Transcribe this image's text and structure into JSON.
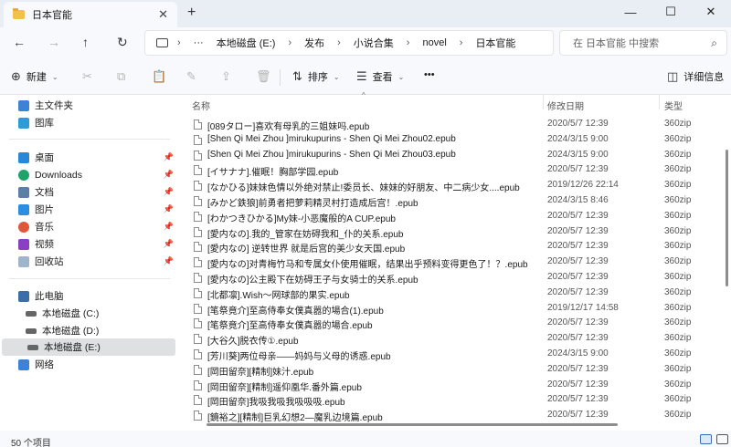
{
  "tab": {
    "title": "日本官能"
  },
  "breadcrumb": [
    "本地磁盘 (E:)",
    "发布",
    "小说合集",
    "novel",
    "日本官能"
  ],
  "search": {
    "placeholder": "在 日本官能 中搜索"
  },
  "toolbar": {
    "new_label": "新建",
    "sort_label": "排序",
    "view_label": "查看",
    "more_label": "•••",
    "details_label": "详细信息"
  },
  "sidebar": {
    "home": "主文件夹",
    "gallery": "图库",
    "quick": [
      "桌面",
      "Downloads",
      "文档",
      "图片",
      "音乐",
      "视频",
      "回收站"
    ],
    "this_pc": "此电脑",
    "drives": [
      "本地磁盘 (C:)",
      "本地磁盘 (D:)",
      "本地磁盘 (E:)"
    ],
    "network": "网络"
  },
  "columns": {
    "name": "名称",
    "date": "修改日期",
    "type": "类型"
  },
  "files": [
    {
      "name": "[089タロー]喜欢有母乳的三姐妹吗.epub",
      "date": "2020/5/7 12:39",
      "type": "360zip"
    },
    {
      "name": "[Shen Qi Mei Zhou ]mirukupurins - Shen Qi Mei Zhou02.epub",
      "date": "2024/3/15 9:00",
      "type": "360zip"
    },
    {
      "name": "[Shen Qi Mei Zhou ]mirukupurins - Shen Qi Mei Zhou03.epub",
      "date": "2024/3/15 9:00",
      "type": "360zip"
    },
    {
      "name": "[イサナナ].催眠！胸部学园.epub",
      "date": "2020/5/7 12:39",
      "type": "360zip"
    },
    {
      "name": "[なかひる]妹妹色情以外绝对禁止!委员长、妹妹的好朋友、中二病少女....epub",
      "date": "2019/12/26 22:14",
      "type": "360zip"
    },
    {
      "name": "[みかど鉄狼]前勇者把萝莉精灵村打造成后宫！.epub",
      "date": "2024/3/15 8:46",
      "type": "360zip"
    },
    {
      "name": "[わかつきひかる]My妹-小恶魔般的A CUP.epub",
      "date": "2020/5/7 12:39",
      "type": "360zip"
    },
    {
      "name": "[愛内なの].我的_管家在妨碍我和_仆的关系.epub",
      "date": "2020/5/7 12:39",
      "type": "360zip"
    },
    {
      "name": "[愛内なの] 逆转世界 就是后宫的美少女天国.epub",
      "date": "2020/5/7 12:39",
      "type": "360zip"
    },
    {
      "name": "[愛内なの]对青梅竹马和专属女仆使用催眠，结果出乎预料变得更色了！？.epub",
      "date": "2020/5/7 12:39",
      "type": "360zip"
    },
    {
      "name": "[愛内なの]公主殿下在妨碍王子与女骑士的关系.epub",
      "date": "2020/5/7 12:39",
      "type": "360zip"
    },
    {
      "name": "[北都凛].Wish～网球部的果实.epub",
      "date": "2020/5/7 12:39",
      "type": "360zip"
    },
    {
      "name": "[笔祭竟介]至高侍奉女僕真嚣的場合(1).epub",
      "date": "2019/12/17 14:58",
      "type": "360zip"
    },
    {
      "name": "[笔祭竟介]至高侍奉女僕真嚣的場合.epub",
      "date": "2020/5/7 12:39",
      "type": "360zip"
    },
    {
      "name": "[大谷久]脱衣传①.epub",
      "date": "2020/5/7 12:39",
      "type": "360zip"
    },
    {
      "name": "[芳川葵]两位母亲——妈妈与义母的诱惑.epub",
      "date": "2024/3/15 9:00",
      "type": "360zip"
    },
    {
      "name": "[岡田留奈][精制]妹汁.epub",
      "date": "2020/5/7 12:39",
      "type": "360zip"
    },
    {
      "name": "[岡田留奈][精制]遥仰凰华.番外篇.epub",
      "date": "2020/5/7 12:39",
      "type": "360zip"
    },
    {
      "name": "[岡田留奈]我吸我吸我吸吸吸.epub",
      "date": "2020/5/7 12:39",
      "type": "360zip"
    },
    {
      "name": "[鏡裕之][精制]巨乳幻想2—魔乳边境篇.epub",
      "date": "2020/5/7 12:39",
      "type": "360zip"
    }
  ],
  "status": {
    "count": "50 个项目"
  }
}
